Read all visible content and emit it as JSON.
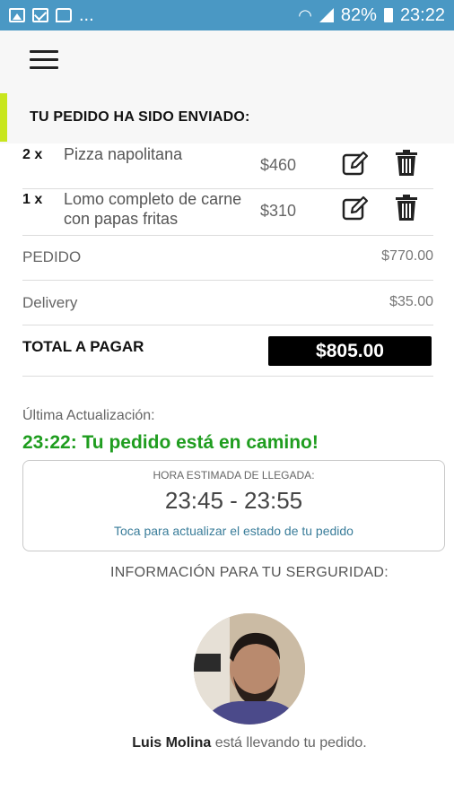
{
  "status_bar": {
    "overflow": "...",
    "battery": "82%",
    "time": "23:22",
    "icons": [
      "image-icon",
      "mail-icon",
      "chat-icon",
      "wifi-icon",
      "signal-icon",
      "battery-icon"
    ]
  },
  "header": {
    "title": "TU PEDIDO HA SIDO ENVIADO:"
  },
  "items": [
    {
      "qty": "2 x",
      "name": "Pizza napolitana",
      "price": "$460"
    },
    {
      "qty": "1 x",
      "name": "Lomo completo de carne con papas fritas",
      "price": "$310"
    }
  ],
  "summary": {
    "order_label": "PEDIDO",
    "order_amount": "$770.00",
    "delivery_label": "Delivery",
    "delivery_amount": "$35.00",
    "total_label": "TOTAL A PAGAR",
    "total_amount": "$805.00"
  },
  "update": {
    "label": "Última Actualización:",
    "status": "23:22: Tu pedido está en camino!"
  },
  "eta": {
    "label": "HORA ESTIMADA DE LLEGADA:",
    "time": "23:45 - 23:55",
    "action": "Toca para actualizar el estado de tu pedido"
  },
  "safety": {
    "title": "INFORMACIÓN PARA TU SERGURIDAD:"
  },
  "driver": {
    "name": "Luis Molina",
    "message": " está llevando tu pedido."
  },
  "colors": {
    "status_bar": "#4a98c4",
    "accent": "#c8e61e",
    "status_green": "#1f9d1f",
    "link": "#3a7d9a"
  }
}
